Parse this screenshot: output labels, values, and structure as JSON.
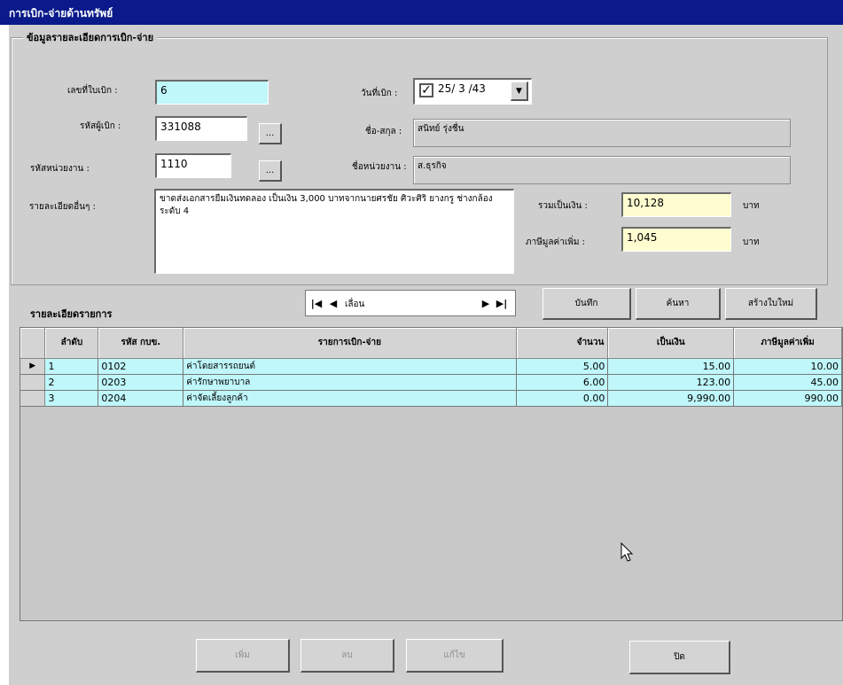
{
  "window": {
    "title": "การเบิก-จ่ายด้านทรัพย์"
  },
  "details": {
    "group_title": "ข้อมูลรายละเอียดการเบิก-จ่าย",
    "voucher_no": {
      "label": "เลขที่ใบเบิก :",
      "value": "6"
    },
    "date": {
      "label": "วันที่เบิก :",
      "value": "25/ 3 /43",
      "checked": true
    },
    "requester_code": {
      "label": "รหัสผู้เบิก :",
      "value": "331088",
      "browse": "..."
    },
    "requester_name": {
      "label": "ชื่อ-สกุล :",
      "value": "สนิทย์ รุ่งชื่น"
    },
    "unit_code": {
      "label": "รหัสหน่วยงาน :",
      "value": "1110",
      "browse": "..."
    },
    "unit_name": {
      "label": "ชื่อหน่วยงาน :",
      "value": "ส.ธุรกิจ"
    },
    "other_details": {
      "label": "รายละเอียดอื่นๆ :",
      "value": "ขาดส่งเอกสารยืมเงินทดลอง เป็นเงิน 3,000 บาทจากนายศรชัย ศิวะศิริ ยางกรู ช่างกล้อง ระดับ 4"
    },
    "total_amount": {
      "label": "รวมเป็นเงิน :",
      "value": "10,128",
      "unit": "บาท"
    },
    "vat": {
      "label": "ภาษีมูลค่าเพิ่ม :",
      "value": "1,045",
      "unit": "บาท"
    }
  },
  "items": {
    "title": "รายละเอียดรายการ",
    "navigator": {
      "first": "|◀",
      "prev": "◀",
      "caption": "เลื่อน",
      "next": "▶",
      "last": "▶|"
    },
    "buttons": {
      "save": "บันทึก",
      "search": "ค้นหา",
      "new": "สร้างใบใหม่"
    },
    "columns": [
      "ลำดับ",
      "รหัส กบข.",
      "รายการเบิก-จ่าย",
      "จำนวน",
      "เป็นเงิน",
      "ภาษีมูลค่าเพิ่ม"
    ],
    "rows": [
      {
        "indicator": "▶",
        "seq": "1",
        "code": "0102",
        "desc": "ค่าโดยสารรถยนต์",
        "qty": "5.00",
        "amount": "15.00",
        "vat": "10.00"
      },
      {
        "indicator": "",
        "seq": "2",
        "code": "0203",
        "desc": "ค่ารักษาพยาบาล",
        "qty": "6.00",
        "amount": "123.00",
        "vat": "45.00"
      },
      {
        "indicator": "",
        "seq": "3",
        "code": "0204",
        "desc": "ค่าจัดเลี้ยงลูกค้า",
        "qty": "0.00",
        "amount": "9,990.00",
        "vat": "990.00"
      }
    ]
  },
  "footer": {
    "add": "เพิ่ม",
    "delete": "ลบ",
    "edit": "แก้ไข",
    "close": "ปิด"
  }
}
